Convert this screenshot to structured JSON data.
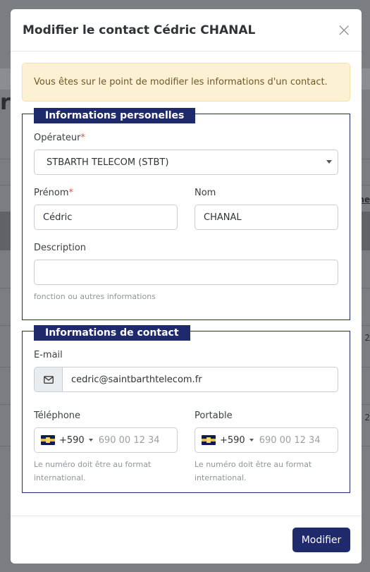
{
  "background": {
    "letter": "r",
    "side_texts": [
      "ne",
      "2",
      "2"
    ]
  },
  "modal": {
    "title": "Modifier le contact Cédric CHANAL",
    "close_glyph": "×",
    "alert": "Vous êtes sur le point de modifier les informations d'un contact.",
    "personal": {
      "legend": "Informations personelles",
      "operator_label": "Opérateur",
      "operator_value": "STBARTH TELECOM (STBT)",
      "firstname_label": "Prénom",
      "firstname_value": "Cédric",
      "lastname_label": "Nom",
      "lastname_value": "CHANAL",
      "description_label": "Description",
      "description_value": "",
      "description_help": "fonction ou autres informations"
    },
    "contact": {
      "legend": "Informations de contact",
      "email_label": "E-mail",
      "email_value": "cedric@saintbarthtelecom.fr",
      "email_icon": "envelope-icon",
      "phone_label": "Téléphone",
      "phone_dial": "+590",
      "phone_placeholder": "690 00 12 34",
      "phone_help": "Le numéro doit être au format international.",
      "mobile_label": "Portable",
      "mobile_dial": "+590",
      "mobile_placeholder": "690 00 12 34",
      "mobile_help": "Le numéro doit être au format international."
    },
    "submit_label": "Modifier"
  },
  "colors": {
    "primary": "#1e2a6b",
    "alert_bg": "#fdf1d3",
    "required": "#d9534f"
  }
}
